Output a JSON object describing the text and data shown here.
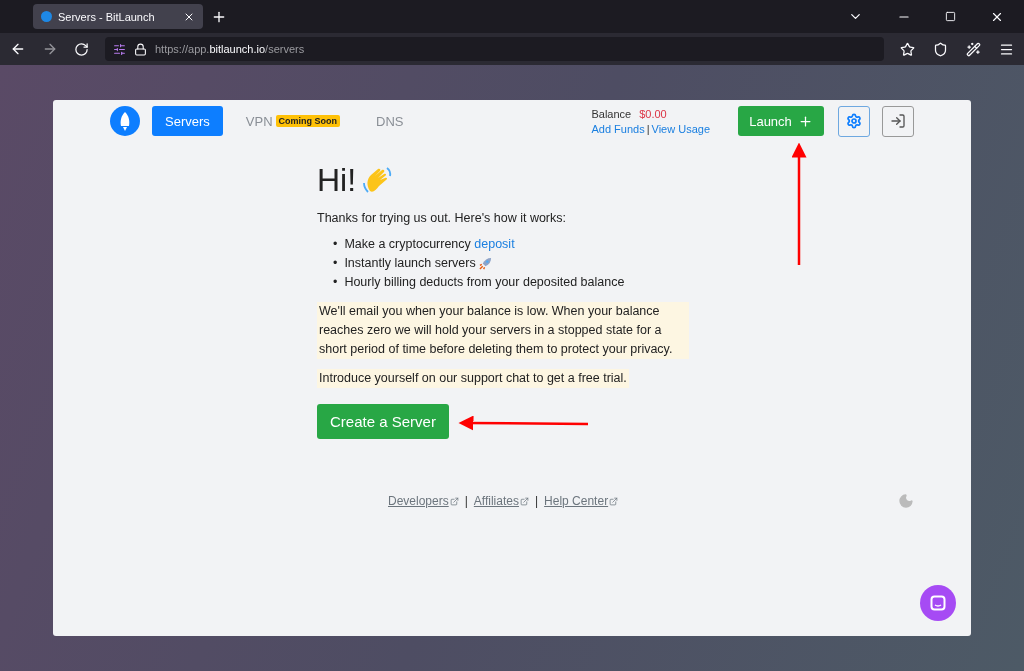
{
  "browser": {
    "tab_title": "Servers - BitLaunch",
    "url_prefix": "https://app.",
    "url_domain": "bitlaunch.io",
    "url_path": "/servers"
  },
  "nav": {
    "tabs": [
      {
        "label": "Servers",
        "selected": true
      },
      {
        "label": "VPN",
        "selected": false,
        "badge": "Coming Soon"
      },
      {
        "label": "DNS",
        "selected": false
      }
    ],
    "balance_label": "Balance",
    "balance_value": "$0.00",
    "add_funds": "Add Funds",
    "separator": "|",
    "view_usage": "View Usage",
    "launch": "Launch"
  },
  "main": {
    "heading": "Hi!",
    "intro": "Thanks for trying us out. Here's how it works:",
    "bullet": "•",
    "steps": [
      {
        "kind": "link",
        "text": "Make a cryptocurrency",
        "link": "deposit"
      },
      {
        "kind": "icon",
        "text": "Instantly launch servers"
      },
      {
        "kind": "plain",
        "text": "Hourly billing deducts from your deposited balance"
      }
    ],
    "notes": [
      "We'll email you when your balance is low. When your balance reaches zero we will hold your servers in a stopped state for a short period of time before deleting them to protect your privacy.",
      "Introduce yourself on our support chat to get a free trial."
    ],
    "create_button": "Create a Server"
  },
  "footer": {
    "links": [
      "Developers",
      "Affiliates",
      "Help Center"
    ],
    "separator": "|"
  }
}
